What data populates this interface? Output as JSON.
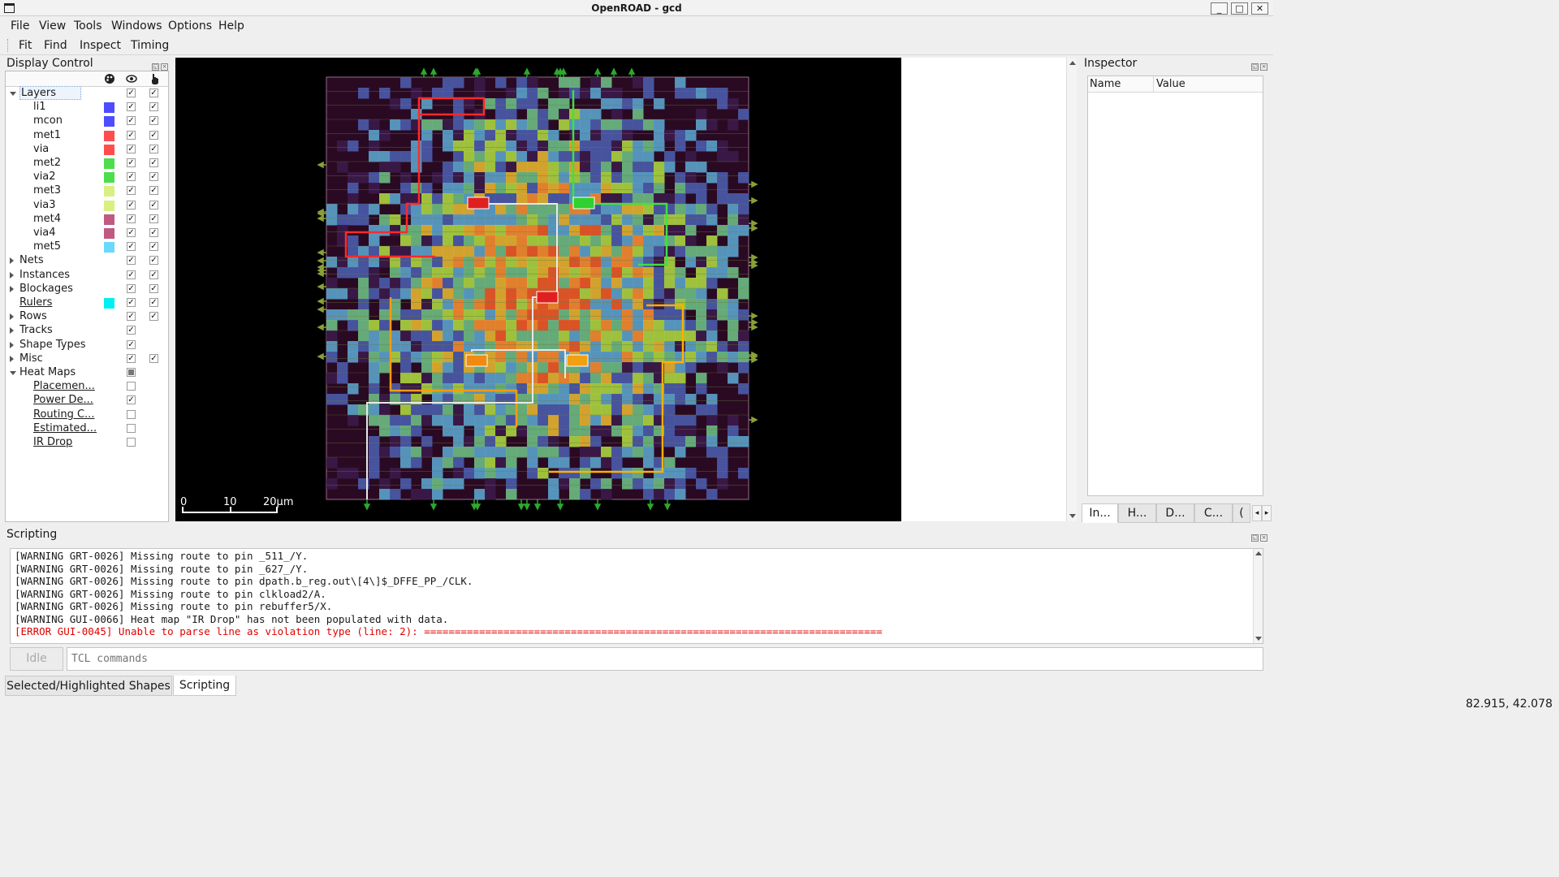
{
  "window": {
    "title": "OpenROAD - gcd",
    "buttons": {
      "minimize": "_",
      "maximize": "□",
      "close": "✕"
    }
  },
  "menu": [
    "File",
    "View",
    "Tools",
    "Windows",
    "Options",
    "Help"
  ],
  "toolbar": [
    "Fit",
    "Find",
    "Inspect",
    "Timing"
  ],
  "display_control": {
    "title": "Display Control",
    "header_icons": [
      "palette-icon",
      "eye-icon",
      "pointer-icon"
    ],
    "rows": [
      {
        "label": "Layers",
        "level": 0,
        "arrow": "down",
        "color": null,
        "visible": "checked",
        "selectable": "checked",
        "underline": false,
        "highlighted": true
      },
      {
        "label": "li1",
        "level": 1,
        "arrow": null,
        "color": "#4d4dff",
        "visible": "checked",
        "selectable": "checked",
        "underline": false
      },
      {
        "label": "mcon",
        "level": 1,
        "arrow": null,
        "color": "#4d4dff",
        "visible": "checked",
        "selectable": "checked",
        "underline": false
      },
      {
        "label": "met1",
        "level": 1,
        "arrow": null,
        "color": "#ff4d4d",
        "visible": "checked",
        "selectable": "checked",
        "underline": false
      },
      {
        "label": "via",
        "level": 1,
        "arrow": null,
        "color": "#ff4d4d",
        "visible": "checked",
        "selectable": "checked",
        "underline": false
      },
      {
        "label": "met2",
        "level": 1,
        "arrow": null,
        "color": "#4ddd4d",
        "visible": "checked",
        "selectable": "checked",
        "underline": false
      },
      {
        "label": "via2",
        "level": 1,
        "arrow": null,
        "color": "#4ddd4d",
        "visible": "checked",
        "selectable": "checked",
        "underline": false
      },
      {
        "label": "met3",
        "level": 1,
        "arrow": null,
        "color": "#d8f080",
        "visible": "checked",
        "selectable": "checked",
        "underline": false
      },
      {
        "label": "via3",
        "level": 1,
        "arrow": null,
        "color": "#d8f080",
        "visible": "checked",
        "selectable": "checked",
        "underline": false
      },
      {
        "label": "met4",
        "level": 1,
        "arrow": null,
        "color": "#c05a80",
        "visible": "checked",
        "selectable": "checked",
        "underline": false
      },
      {
        "label": "via4",
        "level": 1,
        "arrow": null,
        "color": "#c05a80",
        "visible": "checked",
        "selectable": "checked",
        "underline": false
      },
      {
        "label": "met5",
        "level": 1,
        "arrow": null,
        "color": "#6ad8ff",
        "visible": "checked",
        "selectable": "checked",
        "underline": false
      },
      {
        "label": "Nets",
        "level": 0,
        "arrow": "right",
        "color": null,
        "visible": "checked",
        "selectable": "checked",
        "underline": false
      },
      {
        "label": "Instances",
        "level": 0,
        "arrow": "right",
        "color": null,
        "visible": "checked",
        "selectable": "checked",
        "underline": false
      },
      {
        "label": "Blockages",
        "level": 0,
        "arrow": "right",
        "color": null,
        "visible": "checked",
        "selectable": "checked",
        "underline": false
      },
      {
        "label": "Rulers",
        "level": 0,
        "arrow": null,
        "color": "#00f0f0",
        "visible": "checked",
        "selectable": "checked",
        "underline": true
      },
      {
        "label": "Rows",
        "level": 0,
        "arrow": "right",
        "color": null,
        "visible": "checked",
        "selectable": "checked",
        "underline": false
      },
      {
        "label": "Tracks",
        "level": 0,
        "arrow": "right",
        "color": null,
        "visible": "checked",
        "selectable": "none",
        "underline": false
      },
      {
        "label": "Shape Types",
        "level": 0,
        "arrow": "right",
        "color": null,
        "visible": "checked",
        "selectable": "none",
        "underline": false
      },
      {
        "label": "Misc",
        "level": 0,
        "arrow": "right",
        "color": null,
        "visible": "checked",
        "selectable": "checked",
        "underline": false
      },
      {
        "label": "Heat Maps",
        "level": 0,
        "arrow": "down",
        "color": null,
        "visible": "partial",
        "selectable": "none",
        "underline": false
      },
      {
        "label": "Placemen...",
        "level": 1,
        "arrow": null,
        "color": null,
        "visible": "unchecked",
        "selectable": "none",
        "underline": true
      },
      {
        "label": "Power De...",
        "level": 1,
        "arrow": null,
        "color": null,
        "visible": "checked",
        "selectable": "none",
        "underline": true
      },
      {
        "label": "Routing C...",
        "level": 1,
        "arrow": null,
        "color": null,
        "visible": "unchecked",
        "selectable": "none",
        "underline": true
      },
      {
        "label": "Estimated...",
        "level": 1,
        "arrow": null,
        "color": null,
        "visible": "unchecked",
        "selectable": "none",
        "underline": true
      },
      {
        "label": "IR Drop",
        "level": 1,
        "arrow": null,
        "color": null,
        "visible": "unchecked",
        "selectable": "none",
        "underline": true
      }
    ]
  },
  "layout_view": {
    "scale_bar": {
      "ticks": [
        "0",
        "10",
        "20μm"
      ]
    }
  },
  "inspector": {
    "title": "Inspector",
    "columns": [
      "Name",
      "Value"
    ],
    "tabs": [
      "In...",
      "H...",
      "D...",
      "C...",
      "("
    ]
  },
  "scripting": {
    "title": "Scripting",
    "lines": [
      {
        "text": "[WARNING GRT-0026] Missing route to pin _511_/Y.",
        "level": "warning"
      },
      {
        "text": "[WARNING GRT-0026] Missing route to pin _627_/Y.",
        "level": "warning"
      },
      {
        "text": "[WARNING GRT-0026] Missing route to pin dpath.b_reg.out\\[4\\]$_DFFE_PP_/CLK.",
        "level": "warning"
      },
      {
        "text": "[WARNING GRT-0026] Missing route to pin clkload2/A.",
        "level": "warning"
      },
      {
        "text": "[WARNING GRT-0026] Missing route to pin rebuffer5/X.",
        "level": "warning"
      },
      {
        "text": "[WARNING GUI-0066] Heat map \"IR Drop\" has not been populated with data.",
        "level": "warning"
      },
      {
        "text": "[ERROR GUI-0045] Unable to parse line as violation type (line: 2): ===========================================================================",
        "level": "error"
      }
    ],
    "idle_label": "Idle",
    "input_placeholder": "TCL commands"
  },
  "bottom_tabs": [
    {
      "label": "Selected/Highlighted Shapes",
      "active": false
    },
    {
      "label": "Scripting",
      "active": true
    }
  ],
  "status": {
    "coordinates": "82.915, 42.078"
  }
}
